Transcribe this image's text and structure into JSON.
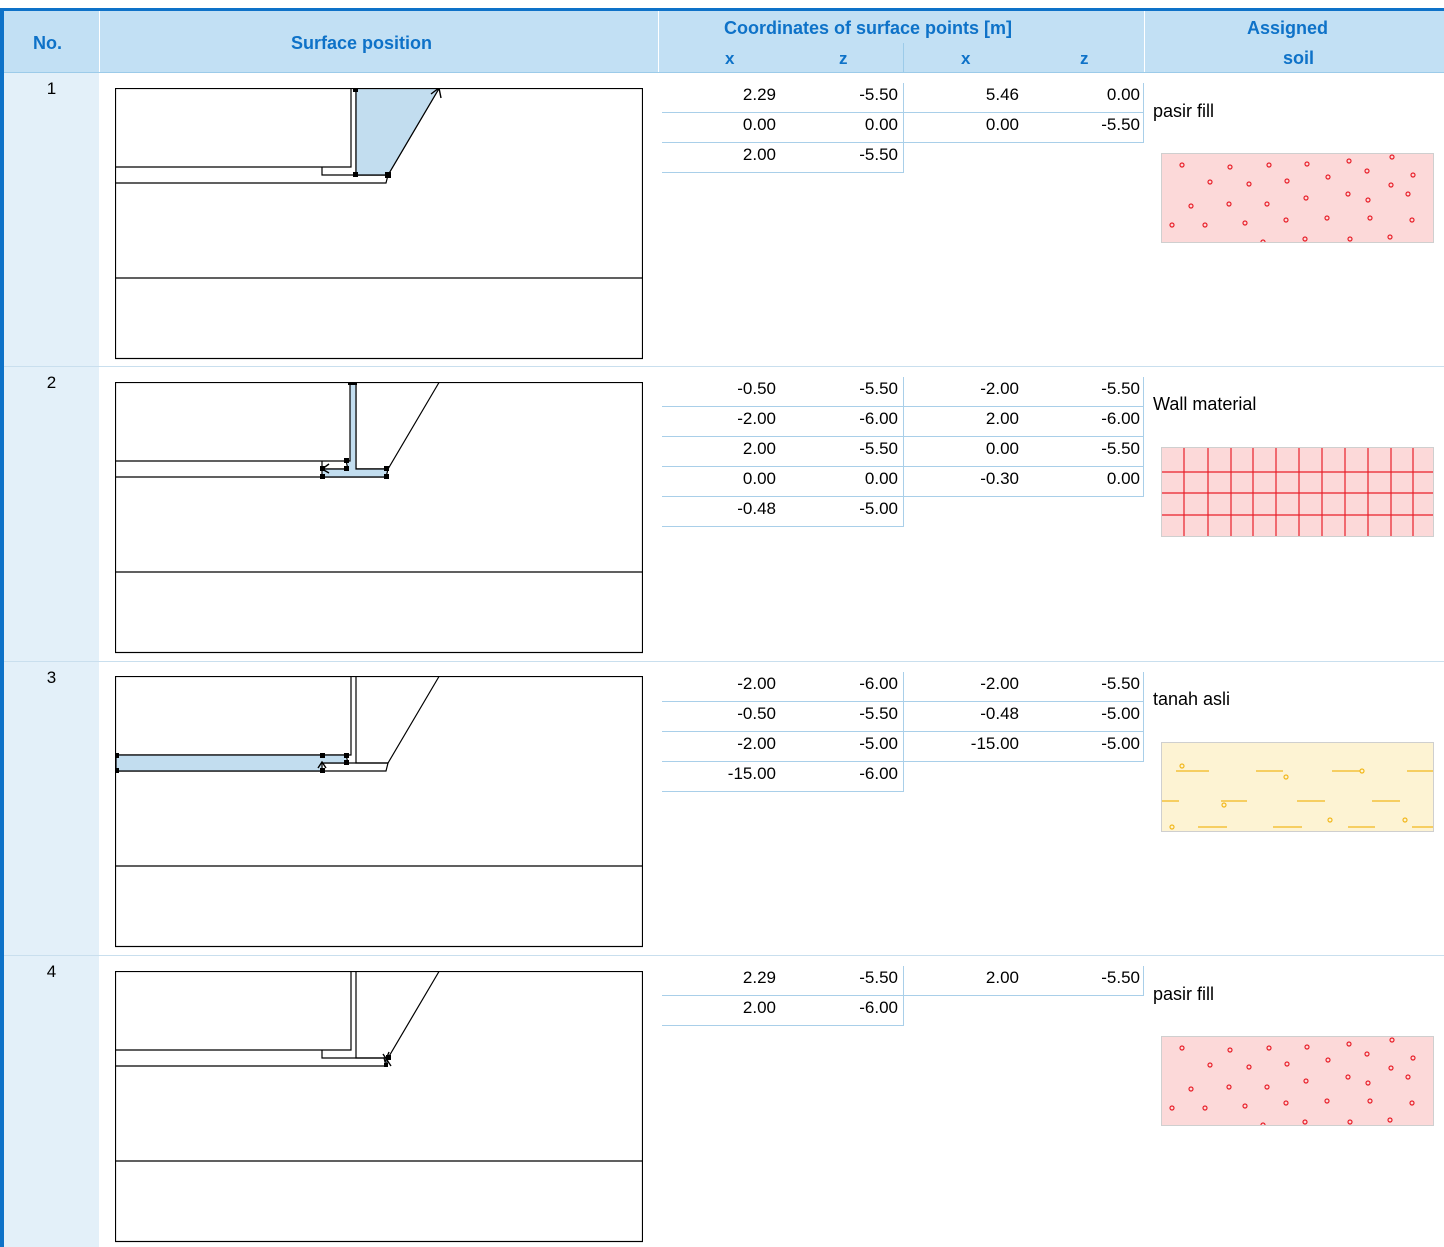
{
  "header": {
    "no": "No.",
    "surface_position": "Surface position",
    "coordinates": "Coordinates of surface points [m]",
    "assigned_line1": "Assigned",
    "assigned_line2": "soil",
    "x1": "x",
    "z1": "z",
    "x2": "x",
    "z2": "z"
  },
  "rows": [
    {
      "no": "1",
      "soil": "pasir fill",
      "pattern": "pasir-fill",
      "coords": [
        [
          "2.29",
          "-5.50",
          "5.46",
          "0.00"
        ],
        [
          "0.00",
          "0.00",
          "0.00",
          "-5.50"
        ],
        [
          "2.00",
          "-5.50",
          "",
          ""
        ]
      ]
    },
    {
      "no": "2",
      "soil": "Wall material",
      "pattern": "wall-material",
      "coords": [
        [
          "-0.50",
          "-5.50",
          "-2.00",
          "-5.50"
        ],
        [
          "-2.00",
          "-6.00",
          "2.00",
          "-6.00"
        ],
        [
          "2.00",
          "-5.50",
          "0.00",
          "-5.50"
        ],
        [
          "0.00",
          "0.00",
          "-0.30",
          "0.00"
        ],
        [
          "-0.48",
          "-5.00",
          "",
          ""
        ]
      ]
    },
    {
      "no": "3",
      "soil": "tanah asli",
      "pattern": "tanah-asli",
      "coords": [
        [
          "-2.00",
          "-6.00",
          "-2.00",
          "-5.50"
        ],
        [
          "-0.50",
          "-5.50",
          "-0.48",
          "-5.00"
        ],
        [
          "-2.00",
          "-5.00",
          "-15.00",
          "-5.00"
        ],
        [
          "-15.00",
          "-6.00",
          "",
          ""
        ]
      ]
    },
    {
      "no": "4",
      "soil": "pasir fill",
      "pattern": "pasir-fill",
      "coords": [
        [
          "2.29",
          "-5.50",
          "2.00",
          "-5.50"
        ],
        [
          "2.00",
          "-6.00",
          "",
          ""
        ]
      ]
    }
  ],
  "colors": {
    "accent": "#0e72c8",
    "header_bg": "#c2e0f4",
    "no_col_bg": "#e3f0f9",
    "highlight_fill": "#c2ddef",
    "pasir_fill_bg": "#fcd9d9",
    "pasir_fill_dot": "#e8202a",
    "wall_bg": "#fcd9d9",
    "wall_grid": "#e8202a",
    "tanah_bg": "#fdf3d3",
    "tanah_mark": "#f2b81d"
  }
}
